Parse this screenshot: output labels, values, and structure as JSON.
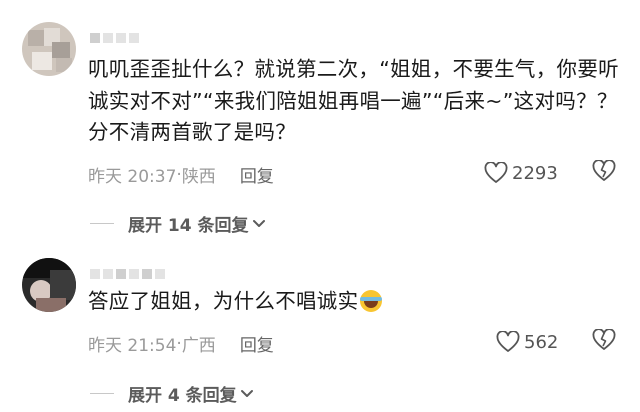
{
  "comments": [
    {
      "text": "叽叽歪歪扯什么？就说第二次，“姐姐，不要生气，你要听诚实对不对”“来我们陪姐姐再唱一遍”“后来~”这对吗？？分不清两首歌了是吗？",
      "time": "昨天 20:37",
      "location": "陕西",
      "reply_label": "回复",
      "likes": "2293",
      "expand_label": "展开 14 条回复"
    },
    {
      "text": "答应了姐姐，为什么不唱诚实",
      "emoji": "crying-laughing-face",
      "time": "昨天 21:54",
      "location": "广西",
      "reply_label": "回复",
      "likes": "562",
      "expand_label": "展开 4 条回复"
    }
  ],
  "separator": "·",
  "colors": {
    "muted": "#9a9a9a",
    "text": "#1a1a1a",
    "icon": "#555555"
  }
}
